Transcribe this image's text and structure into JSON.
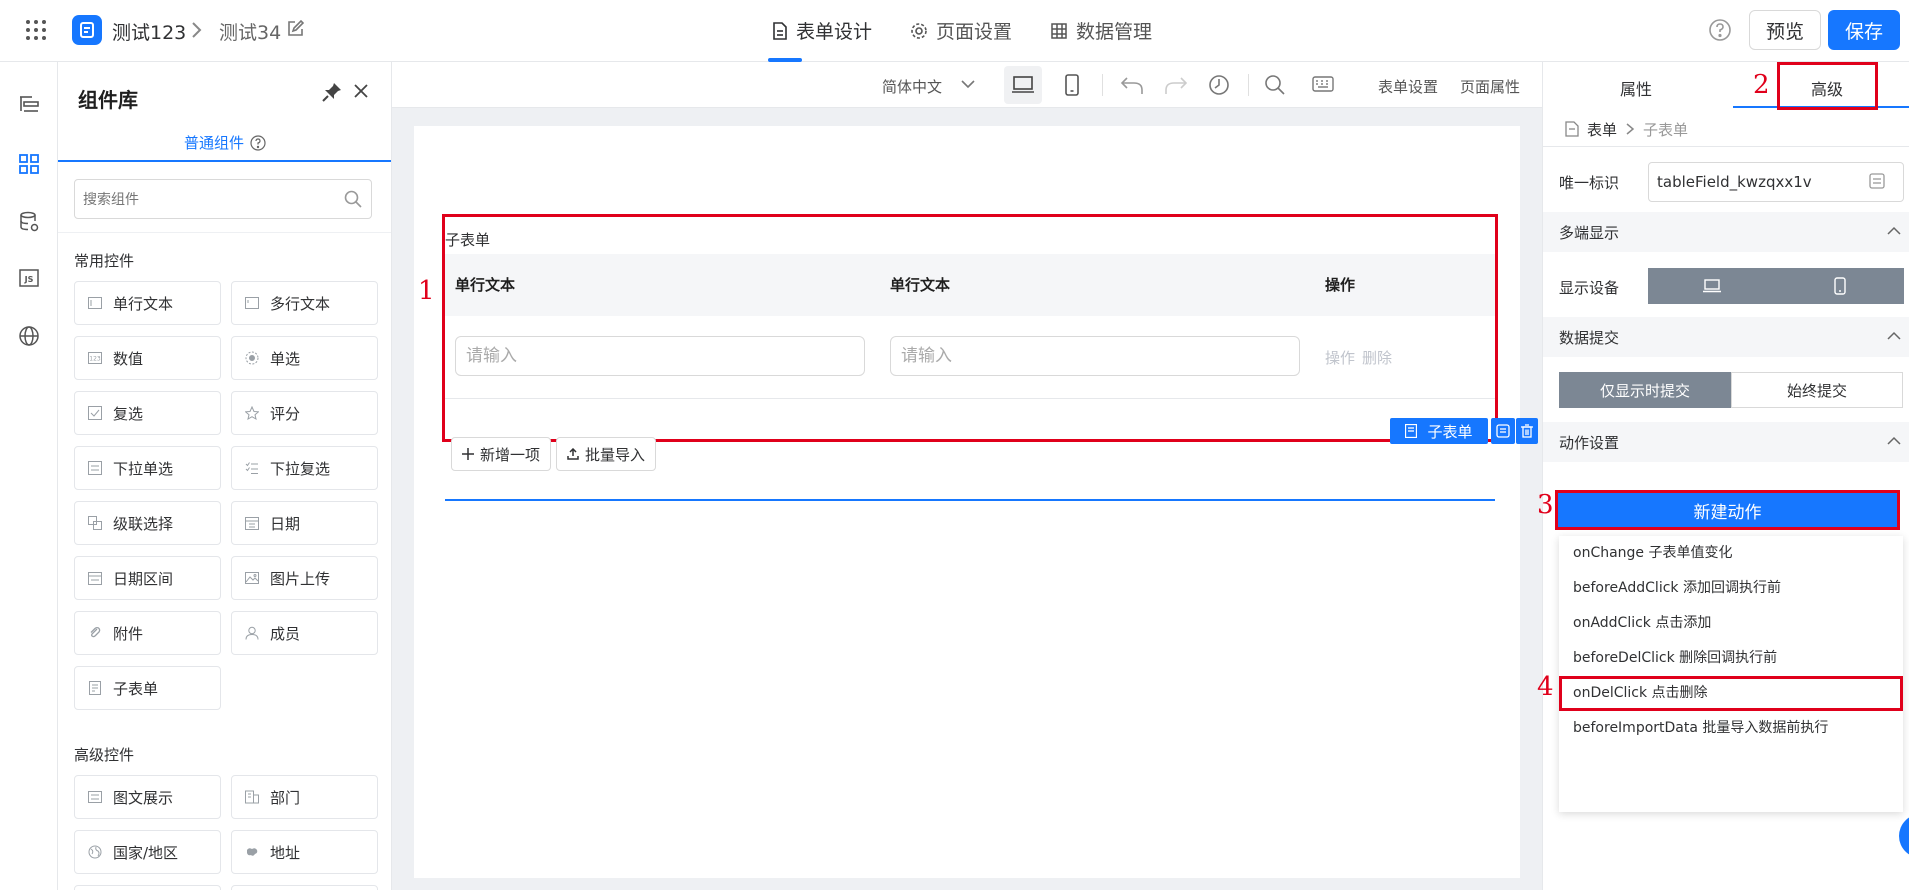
{
  "topbar": {
    "app_name": "测试123",
    "page_name": "测试34",
    "tabs": [
      {
        "label": "表单设计",
        "icon": "document-icon",
        "active": true
      },
      {
        "label": "页面设置",
        "icon": "gear-icon",
        "active": false
      },
      {
        "label": "数据管理",
        "icon": "table-icon",
        "active": false
      }
    ],
    "preview_label": "预览",
    "save_label": "保存",
    "accent": "#1677ff"
  },
  "rail": {
    "items": [
      {
        "icon": "outline-icon"
      },
      {
        "icon": "components-icon",
        "active": true
      },
      {
        "icon": "datasource-icon"
      },
      {
        "icon": "js-icon",
        "text": "JS"
      },
      {
        "icon": "globe-icon"
      }
    ]
  },
  "components": {
    "title": "组件库",
    "tab_label": "普通组件",
    "search_placeholder": "搜索组件",
    "groups": [
      {
        "title": "常用控件",
        "items": [
          "单行文本",
          "多行文本",
          "数值",
          "单选",
          "复选",
          "评分",
          "下拉单选",
          "下拉复选",
          "级联选择",
          "日期",
          "日期区间",
          "图片上传",
          "附件",
          "成员",
          "子表单"
        ]
      },
      {
        "title": "高级控件",
        "items": [
          "图文展示",
          "部门",
          "国家/地区",
          "地址"
        ]
      }
    ]
  },
  "toolbar": {
    "language": "简体中文",
    "form_settings": "表单设置",
    "page_props": "页面属性"
  },
  "subform": {
    "title": "子表单",
    "columns": [
      "单行文本",
      "单行文本",
      "操作"
    ],
    "row": {
      "placeholder1": "请输入",
      "placeholder2": "请输入",
      "op1": "操作",
      "op2": "删除"
    },
    "add_button": "新增一项",
    "import_button": "批量导入",
    "tag_label": "子表单"
  },
  "annotations": [
    "1",
    "2",
    "3",
    "4"
  ],
  "right_panel": {
    "tabs": [
      "属性",
      "高级"
    ],
    "active_tab": "高级",
    "breadcrumb": [
      "表单",
      "子表单"
    ],
    "unique_id_label": "唯一标识",
    "unique_id_value": "tableField_kwzqxx1v",
    "section_multi": "多端显示",
    "device_label": "显示设备",
    "section_submit": "数据提交",
    "submit_options": [
      "仅显示时提交",
      "始终提交"
    ],
    "submit_selected": "仅显示时提交",
    "section_action": "动作设置",
    "new_action_label": "新建动作",
    "action_events": [
      "onChange 子表单值变化",
      "beforeAddClick 添加回调执行前",
      "onAddClick 点击添加",
      "beforeDelClick 删除回调执行前",
      "onDelClick 点击删除",
      "beforeImportData 批量导入数据前执行"
    ],
    "highlighted_event": "onDelClick 点击删除"
  }
}
